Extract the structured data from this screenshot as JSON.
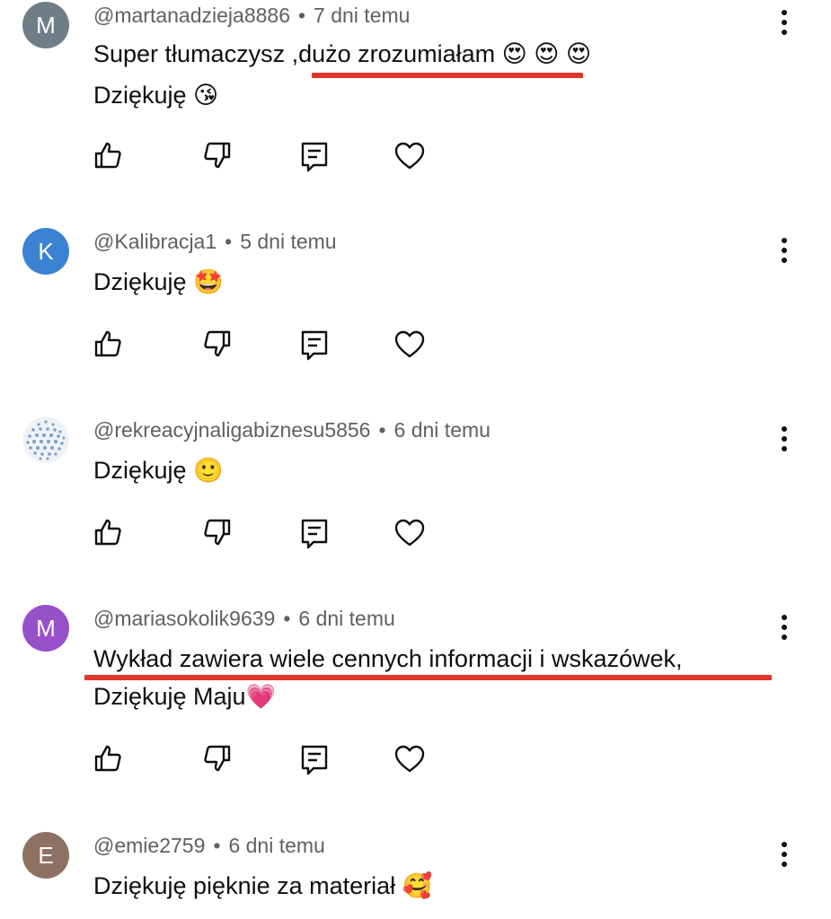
{
  "accent_color": "#e0362b",
  "comments": [
    {
      "avatar_letter": "M",
      "avatar_color": "#6f7d86",
      "author": "@martanadzieja8886",
      "separator": "•",
      "time": "7 dni temu",
      "line1": "Super tłumaczysz ,dużo zrozumiałam 😍 😍 😍",
      "line2": "Dziękuję 😘",
      "menu_icon": "more-vertical-icon"
    },
    {
      "avatar_letter": "K",
      "avatar_color": "#3c82d3",
      "author": "@Kalibracja1",
      "separator": "•",
      "time": "5 dni temu",
      "line1": "Dziękuję 🤩",
      "menu_icon": "more-vertical-icon"
    },
    {
      "avatar_letter": "",
      "avatar_color": "#f2f5f8",
      "author": "@rekreacyjnaligabiznesu5856",
      "separator": "•",
      "time": "6 dni temu",
      "line1": "Dziękuję 🙂",
      "menu_icon": "more-vertical-icon"
    },
    {
      "avatar_letter": "M",
      "avatar_color": "#9850c9",
      "author": "@mariasokolik9639",
      "separator": "•",
      "time": "6 dni temu",
      "line1": "Wykład zawiera wiele cennych informacji i wskazówek,",
      "line2": "Dziękuję Maju💗",
      "menu_icon": "more-vertical-icon"
    },
    {
      "avatar_letter": "E",
      "avatar_color": "#8d7264",
      "author": "@emie2759",
      "separator": "•",
      "time": "6 dni temu",
      "line1": "Dziękuję pięknie za materiał 🥰",
      "menu_icon": "more-vertical-icon"
    }
  ],
  "action_icons": [
    "like-icon",
    "dislike-icon",
    "reply-icon",
    "heart-icon"
  ]
}
